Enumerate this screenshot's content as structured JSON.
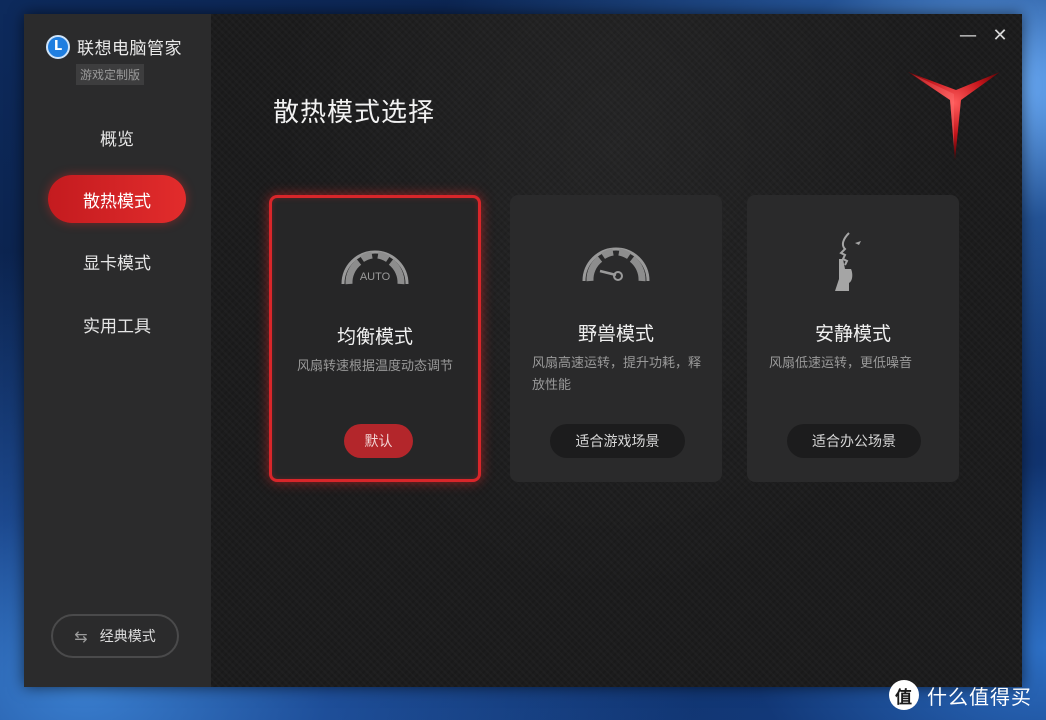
{
  "app": {
    "name": "联想电脑管家",
    "edition": "游戏定制版",
    "logo_letter": "L"
  },
  "sidebar": {
    "items": [
      {
        "label": "概览",
        "active": false
      },
      {
        "label": "散热模式",
        "active": true
      },
      {
        "label": "显卡模式",
        "active": false
      },
      {
        "label": "实用工具",
        "active": false
      }
    ],
    "classic_mode_label": "经典模式",
    "classic_mode_icon": "swap-arrows-icon"
  },
  "window_controls": {
    "minimize": "—",
    "close": "✕"
  },
  "main": {
    "title": "散热模式选择",
    "cards": [
      {
        "title": "均衡模式",
        "desc": "风扇转速根据温度动态调节",
        "gauge_text": "AUTO",
        "button": "默认",
        "selected": true,
        "icon": "auto-gauge-icon"
      },
      {
        "title": "野兽模式",
        "desc": "风扇高速运转，提升功耗，释放性能",
        "button": "适合游戏场景",
        "selected": false,
        "icon": "speedometer-icon"
      },
      {
        "title": "安静模式",
        "desc": "风扇低速运转，更低噪音",
        "button": "适合办公场景",
        "selected": false,
        "icon": "shush-gesture-icon"
      }
    ]
  },
  "colors": {
    "accent_red": "#d8262a",
    "sidebar_bg": "#2b2b2c",
    "main_bg": "#1c1c1d"
  },
  "watermark": {
    "badge": "值",
    "text": "什么值得买"
  }
}
